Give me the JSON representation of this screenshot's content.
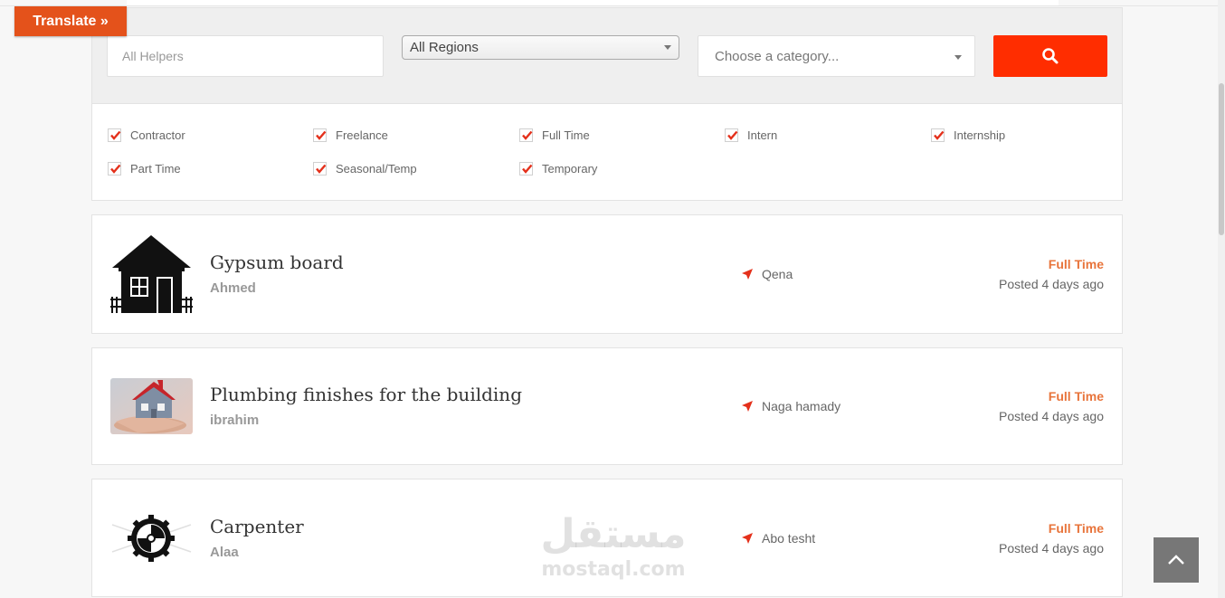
{
  "translate": {
    "label": "Translate »"
  },
  "filters": {
    "helpers_placeholder": "All Helpers",
    "region_selected": "All Regions",
    "category_placeholder": "Choose a category...",
    "search_icon": "search-icon",
    "job_types": [
      {
        "label": "Contractor",
        "checked": true
      },
      {
        "label": "Freelance",
        "checked": true
      },
      {
        "label": "Full Time",
        "checked": true
      },
      {
        "label": "Intern",
        "checked": true
      },
      {
        "label": "Internship",
        "checked": true
      },
      {
        "label": "Part Time",
        "checked": true
      },
      {
        "label": "Seasonal/Temp",
        "checked": true
      },
      {
        "label": "Temporary",
        "checked": true
      }
    ]
  },
  "jobs": [
    {
      "title": "Gypsum board",
      "company": "Ahmed",
      "location": "Qena",
      "type": "Full Time",
      "posted": "Posted 4 days ago",
      "logo": "house-icon"
    },
    {
      "title": "Plumbing finishes for the building",
      "company": "ibrahim",
      "location": "Naga hamady",
      "type": "Full Time",
      "posted": "Posted 4 days ago",
      "logo": "house-in-hand-image"
    },
    {
      "title": "Carpenter",
      "company": "Alaa",
      "location": "Abo tesht",
      "type": "Full Time",
      "posted": "Posted 4 days ago",
      "logo": "saw-blade-icon"
    }
  ],
  "watermark": {
    "arabic": "مستقل",
    "latin": "mostaql.com"
  },
  "colors": {
    "accent": "#ff2d00",
    "translate": "#e4521b",
    "job_type": "#e8743b"
  }
}
